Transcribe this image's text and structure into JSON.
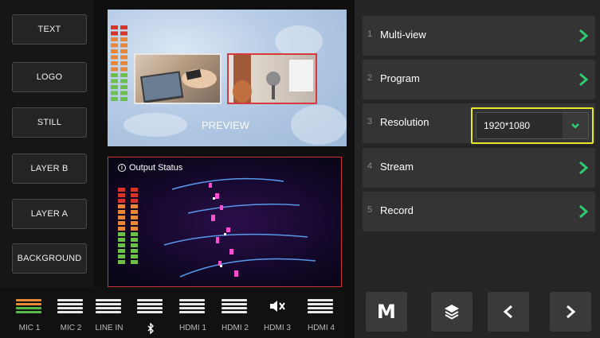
{
  "layers": [
    "TEXT",
    "LOGO",
    "STILL",
    "LAYER B",
    "LAYER A",
    "BACKGROUND"
  ],
  "preview": {
    "label": "PREVIEW"
  },
  "output": {
    "title": "Output Status"
  },
  "audio_channels": [
    {
      "label": "MIC 1",
      "active": true,
      "icon": "fader-icon"
    },
    {
      "label": "MIC 2",
      "active": false,
      "icon": "fader-icon"
    },
    {
      "label": "LINE IN",
      "active": false,
      "icon": "fader-icon"
    },
    {
      "label": "",
      "active": false,
      "icon": "bluetooth-icon"
    },
    {
      "label": "HDMI 1",
      "active": false,
      "icon": "fader-icon"
    },
    {
      "label": "HDMI 2",
      "active": false,
      "icon": "fader-icon"
    },
    {
      "label": "HDMI 3",
      "active": false,
      "icon": "muted-speaker-icon"
    },
    {
      "label": "HDMI 4",
      "active": false,
      "icon": "fader-icon"
    }
  ],
  "menu": [
    {
      "num": "1",
      "label": "Multi-view"
    },
    {
      "num": "2",
      "label": "Program"
    },
    {
      "num": "3",
      "label": "Resolution",
      "value": "1920*1080"
    },
    {
      "num": "4",
      "label": "Stream"
    },
    {
      "num": "5",
      "label": "Record"
    }
  ],
  "bottom": {
    "m_label": "M"
  },
  "colors": {
    "accent": "#2ecc71",
    "highlight": "#e8e82a",
    "output_border": "#cc3333",
    "meter_orange": "#e8873a",
    "meter_green": "#6cc04a"
  }
}
